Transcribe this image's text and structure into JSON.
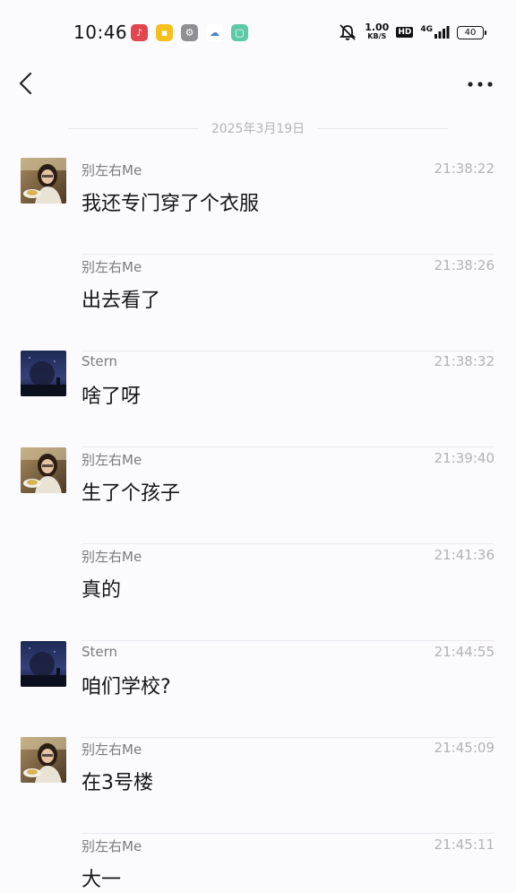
{
  "status_bar": {
    "time": "10:46",
    "app_icons": [
      {
        "name": "music-app-icon",
        "color": "#e2454d",
        "glyph": "♪"
      },
      {
        "name": "notes-app-icon",
        "color": "#f4c01b",
        "glyph": "▪"
      },
      {
        "name": "settings-app-icon",
        "color": "#8e8e93",
        "glyph": "⚙"
      },
      {
        "name": "cloud-app-icon",
        "color": "#ffffff",
        "glyph": "☁"
      },
      {
        "name": "messages-app-icon",
        "color": "#5dcaa7",
        "glyph": "▢"
      }
    ],
    "net_speed_value": "1.00",
    "net_speed_unit": "KB/S",
    "hd_label": "HD",
    "network_label": "4G",
    "battery": "40"
  },
  "header": {
    "back_icon": "chevron-left-icon",
    "more_icon": "more-horizontal-icon"
  },
  "date_separator": "2025年3月19日",
  "messages": [
    {
      "sender": "别左右Me",
      "time": "21:38:22",
      "text": "我还专门穿了个衣服",
      "avatar": "girl"
    },
    {
      "sender": "别左右Me",
      "time": "21:38:26",
      "text": "出去看了",
      "avatar": ""
    },
    {
      "sender": "Stern",
      "time": "21:38:32",
      "text": "啥了呀",
      "avatar": "night"
    },
    {
      "sender": "别左右Me",
      "time": "21:39:40",
      "text": "生了个孩子",
      "avatar": "girl"
    },
    {
      "sender": "别左右Me",
      "time": "21:41:36",
      "text": "真的",
      "avatar": ""
    },
    {
      "sender": "Stern",
      "time": "21:44:55",
      "text": "咱们学校?",
      "avatar": "night"
    },
    {
      "sender": "别左右Me",
      "time": "21:45:09",
      "text": "在3号楼",
      "avatar": "girl"
    },
    {
      "sender": "别左右Me",
      "time": "21:45:11",
      "text": "大一",
      "avatar": ""
    }
  ]
}
